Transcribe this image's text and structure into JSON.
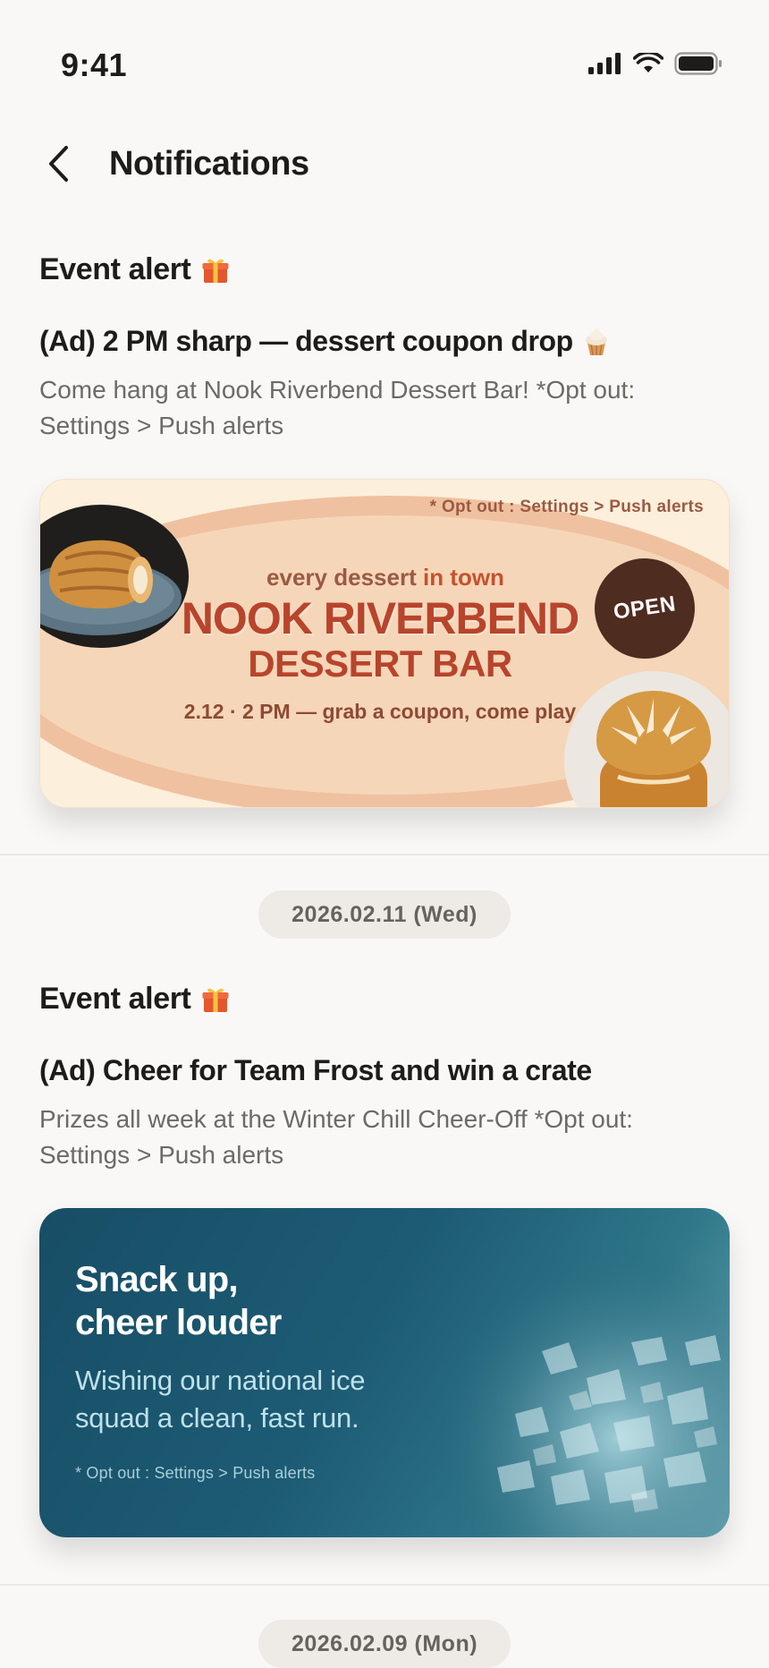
{
  "status_bar": {
    "time": "9:41"
  },
  "nav": {
    "title": "Notifications"
  },
  "notifications": [
    {
      "type_label": "Event alert",
      "type_icon": "gift-icon",
      "title": "(Ad) 2 PM sharp — dessert coupon drop",
      "title_icon": "cupcake-icon",
      "body": "Come hang at Nook Riverbend Dessert Bar! *Opt out: Settings > Push alerts",
      "banner": {
        "opt_out": "* Opt out : Settings > Push alerts",
        "eyebrow_pre": "every dessert",
        "eyebrow_accent": "in town",
        "brand_line1": "NOOK RIVERBEND",
        "brand_line2": "DESSERT BAR",
        "date_line": "2.12 · 2 PM — grab a coupon, come play",
        "badge": "OPEN"
      }
    },
    {
      "type_label": "Event alert",
      "type_icon": "gift-icon",
      "title": "(Ad) Cheer for Team Frost and win a crate",
      "body": "Prizes all week at the Winter Chill Cheer-Off *Opt out: Settings > Push alerts",
      "banner": {
        "heading_line1": "Snack up,",
        "heading_line2": "cheer louder",
        "sub_line1": "Wishing our national ice",
        "sub_line2": "squad a clean, fast run.",
        "opt_out": "* Opt out : Settings > Push alerts"
      }
    }
  ],
  "date_separators": [
    "2026.02.11 (Wed)",
    "2026.02.09 (Mon)"
  ],
  "colors": {
    "background": "#f9f8f6",
    "brand_red": "#b8442c",
    "ice_blue": "#174e66"
  }
}
